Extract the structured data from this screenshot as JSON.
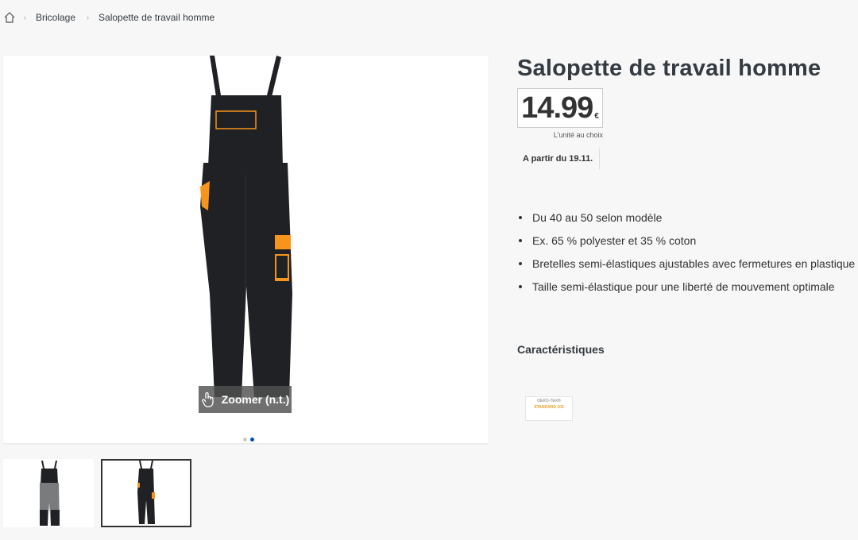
{
  "breadcrumb": {
    "home_icon": "home-icon",
    "items": [
      "Bricolage",
      "Salopette de travail homme"
    ]
  },
  "gallery": {
    "zoom_label": "Zoomer (n.t.)",
    "zoom_icon": "hand-pointer-icon",
    "dots": 2,
    "active_dot": 1
  },
  "product": {
    "title": "Salopette de travail homme",
    "price": "14.99",
    "currency": "€",
    "unit_note": "L'unité au choix",
    "availability": "A partir du 19.11.",
    "features": [
      "Du 40 au 50 selon modèle",
      "Ex. 65 % polyester et 35 % coton",
      "Bretelles semi-élastiques ajustables avec fermetures en plastique",
      "Taille semi-élastique pour une liberté de mouvement optimale"
    ],
    "characteristics_title": "Caractéristiques",
    "badge": {
      "line1": "OEKO-TEX®",
      "line2": "STANDARD 100"
    }
  },
  "colors": {
    "accent_orange": "#f7941d",
    "garment_black": "#1f2124",
    "garment_grey": "#7a7b7d",
    "active_dot": "#0050aa"
  }
}
